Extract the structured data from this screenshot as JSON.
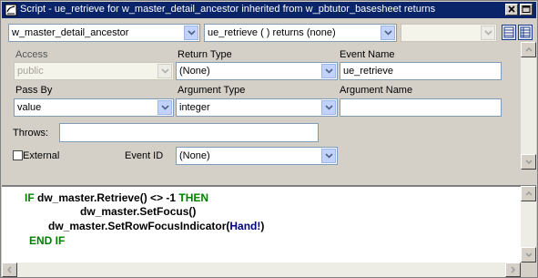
{
  "window": {
    "title": "Script - ue_retrieve for w_master_detail_ancestor inherited from w_pbtutor_basesheet returns"
  },
  "toolbar": {
    "object_combo": "w_master_detail_ancestor",
    "event_combo": "ue_retrieve ( ) returns (none)",
    "third_combo": ""
  },
  "properties": {
    "access_label": "Access",
    "access_value": "public",
    "return_type_label": "Return Type",
    "return_type_value": "(None)",
    "event_name_label": "Event Name",
    "event_name_value": "ue_retrieve",
    "pass_by_label": "Pass By",
    "pass_by_value": "value",
    "argument_type_label": "Argument Type",
    "argument_type_value": "integer",
    "argument_name_label": "Argument Name",
    "argument_name_value": "",
    "throws_label": "Throws:",
    "throws_value": "",
    "external_label": "External",
    "event_id_label": "Event ID",
    "event_id_value": "(None)"
  },
  "code": {
    "line1_kw1": "IF",
    "line1_mid": " dw_master.Retrieve() <> -1 ",
    "line1_kw2": "THEN",
    "line2": "dw_master.SetFocus()",
    "line3_pre": "dw_master.SetRowFocusIndicator(",
    "line3_hand": "Hand!",
    "line3_post": ")",
    "line4": "END IF"
  },
  "colors": {
    "titlebar": "#0a246a",
    "keyword": "#008000",
    "enum": "#000080"
  }
}
